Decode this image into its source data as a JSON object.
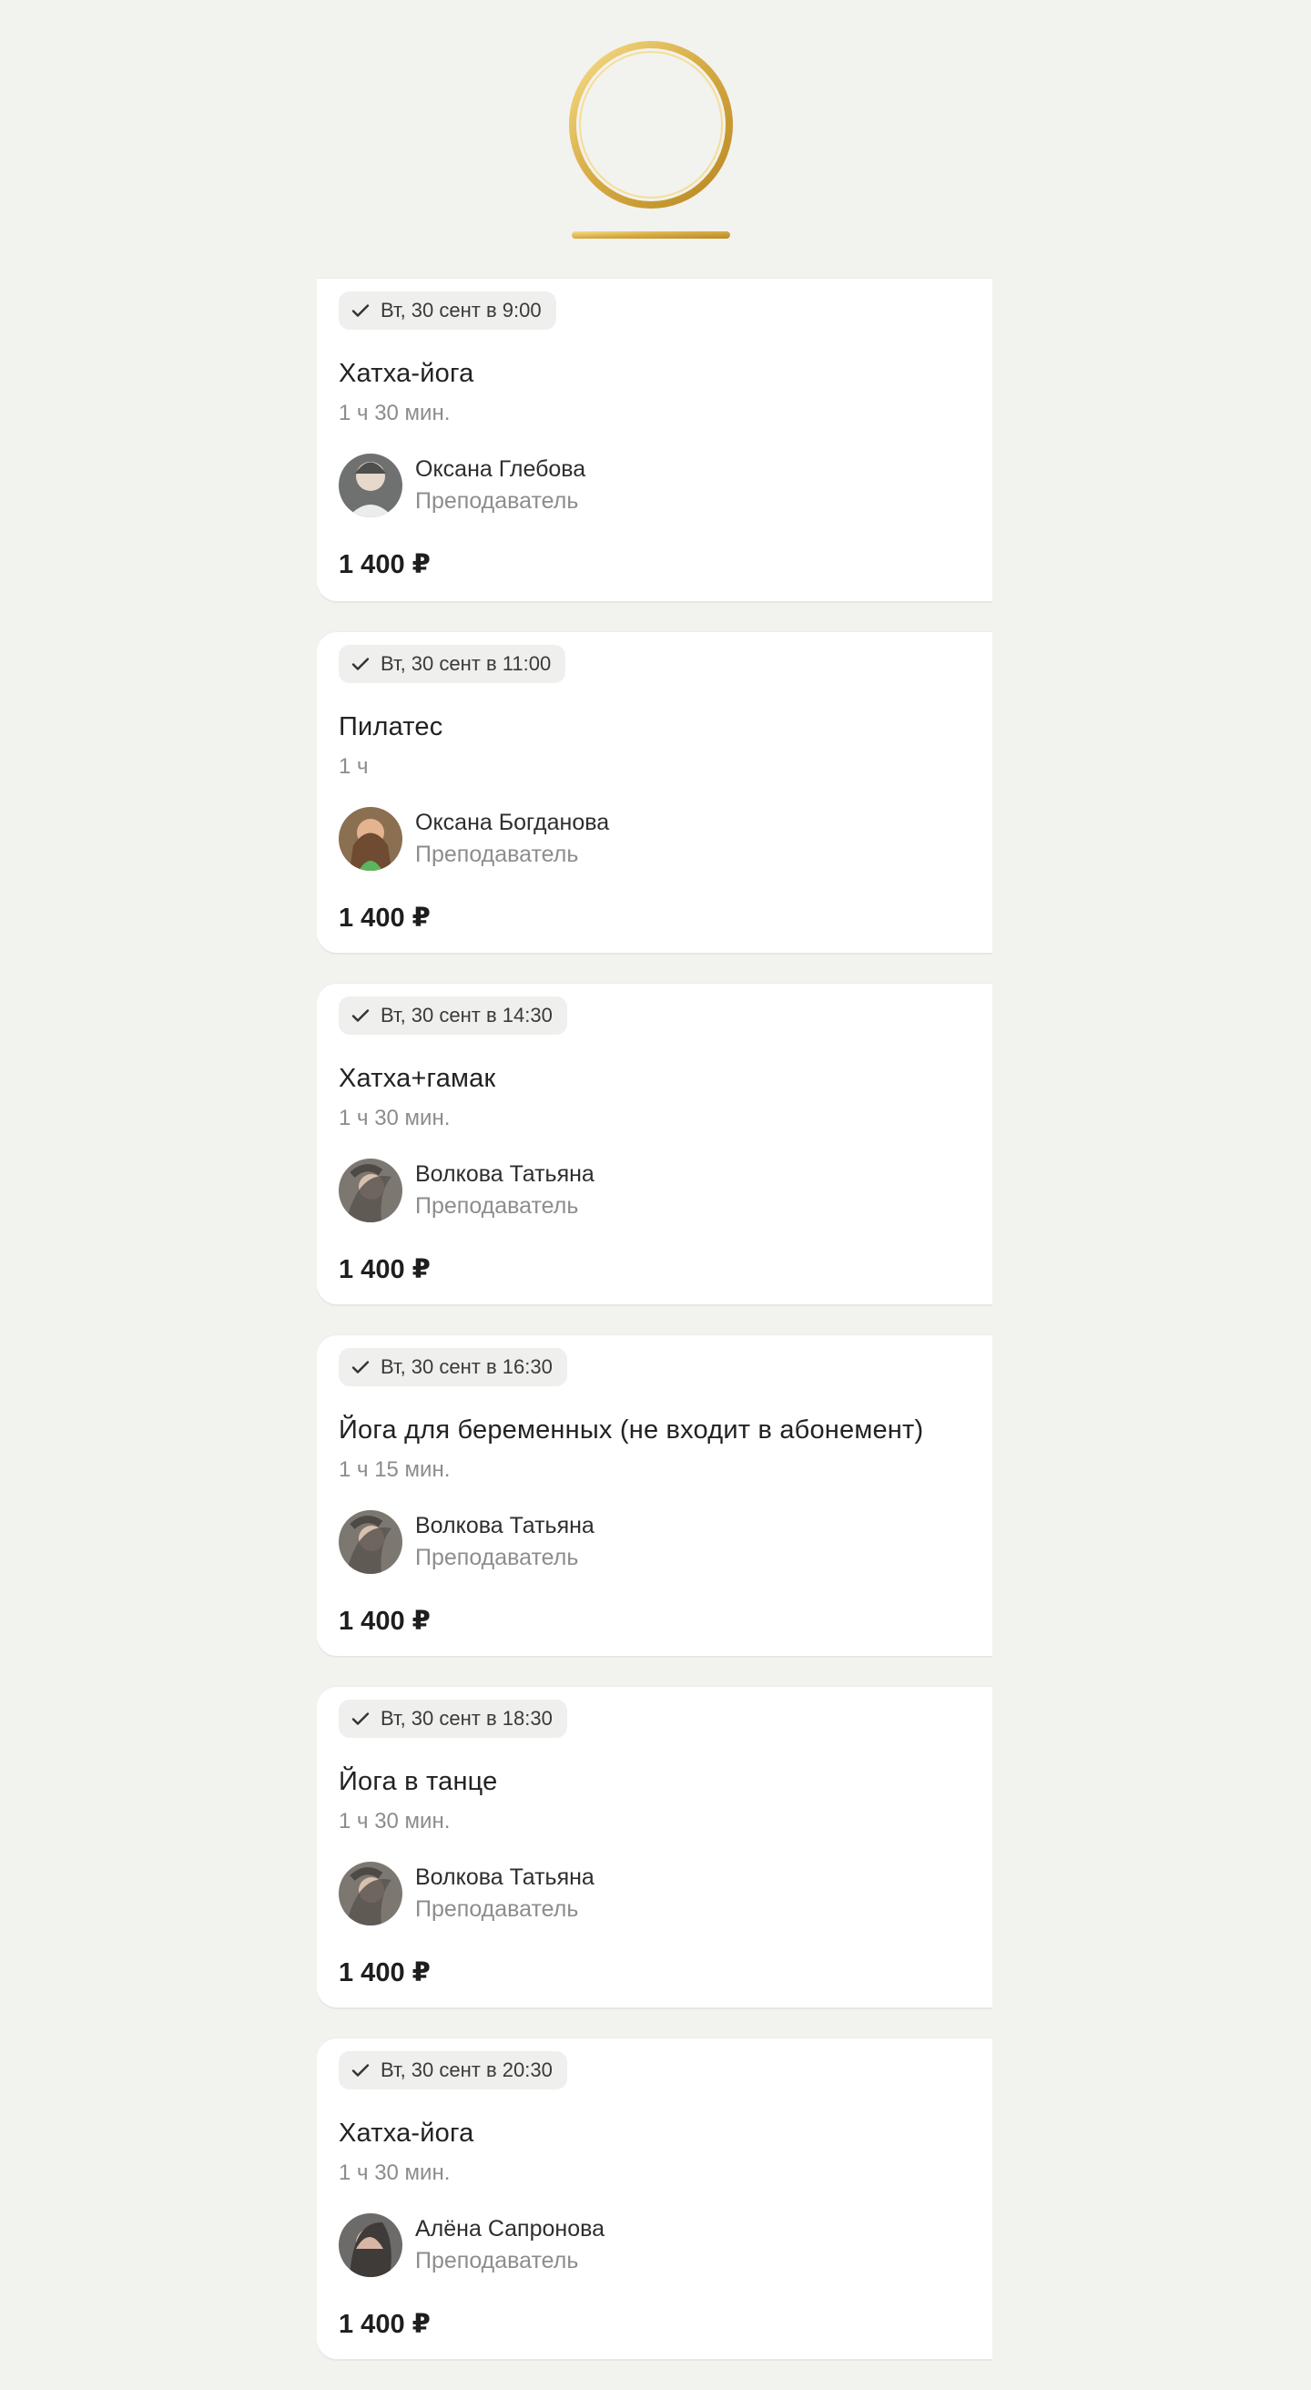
{
  "classes": [
    {
      "badge": "Вт, 30 сент в 9:00",
      "title": "Хатха-йога",
      "duration": "1 ч 30 мин.",
      "teacher": "Оксана Глебова",
      "role": "Преподаватель",
      "price": "1 400 ₽",
      "avatar": "avatar-1"
    },
    {
      "badge": "Вт, 30 сент в 11:00",
      "title": "Пилатес",
      "duration": "1 ч",
      "teacher": "Оксана Богданова",
      "role": "Преподаватель",
      "price": "1 400 ₽",
      "avatar": "avatar-2"
    },
    {
      "badge": "Вт, 30 сент в 14:30",
      "title": "Хатха+гамак",
      "duration": "1 ч 30 мин.",
      "teacher": "Волкова Татьяна",
      "role": "Преподаватель",
      "price": "1 400 ₽",
      "avatar": "avatar-3"
    },
    {
      "badge": "Вт, 30 сент в 16:30",
      "title": "Йога для беременных (не входит в абонемент)",
      "duration": "1 ч 15 мин.",
      "teacher": "Волкова Татьяна",
      "role": "Преподаватель",
      "price": "1 400 ₽",
      "avatar": "avatar-3"
    },
    {
      "badge": "Вт, 30 сент в 18:30",
      "title": "Йога в танце",
      "duration": "1 ч 30 мин.",
      "teacher": "Волкова Татьяна",
      "role": "Преподаватель",
      "price": "1 400 ₽",
      "avatar": "avatar-3"
    },
    {
      "badge": "Вт, 30 сент в 20:30",
      "title": "Хатха-йога",
      "duration": "1 ч 30 мин.",
      "teacher": "Алёна Сапронова",
      "role": "Преподаватель",
      "price": "1 400 ₽",
      "avatar": "avatar-4"
    }
  ],
  "colors": {
    "background": "#f2f2ef",
    "card": "#ffffff",
    "badge": "#efefed",
    "muted_text": "#8c8c8c",
    "logo_gold": "#d8ad45"
  },
  "icons": {
    "logo": "gold-ring-logo",
    "badge": "check-icon"
  }
}
